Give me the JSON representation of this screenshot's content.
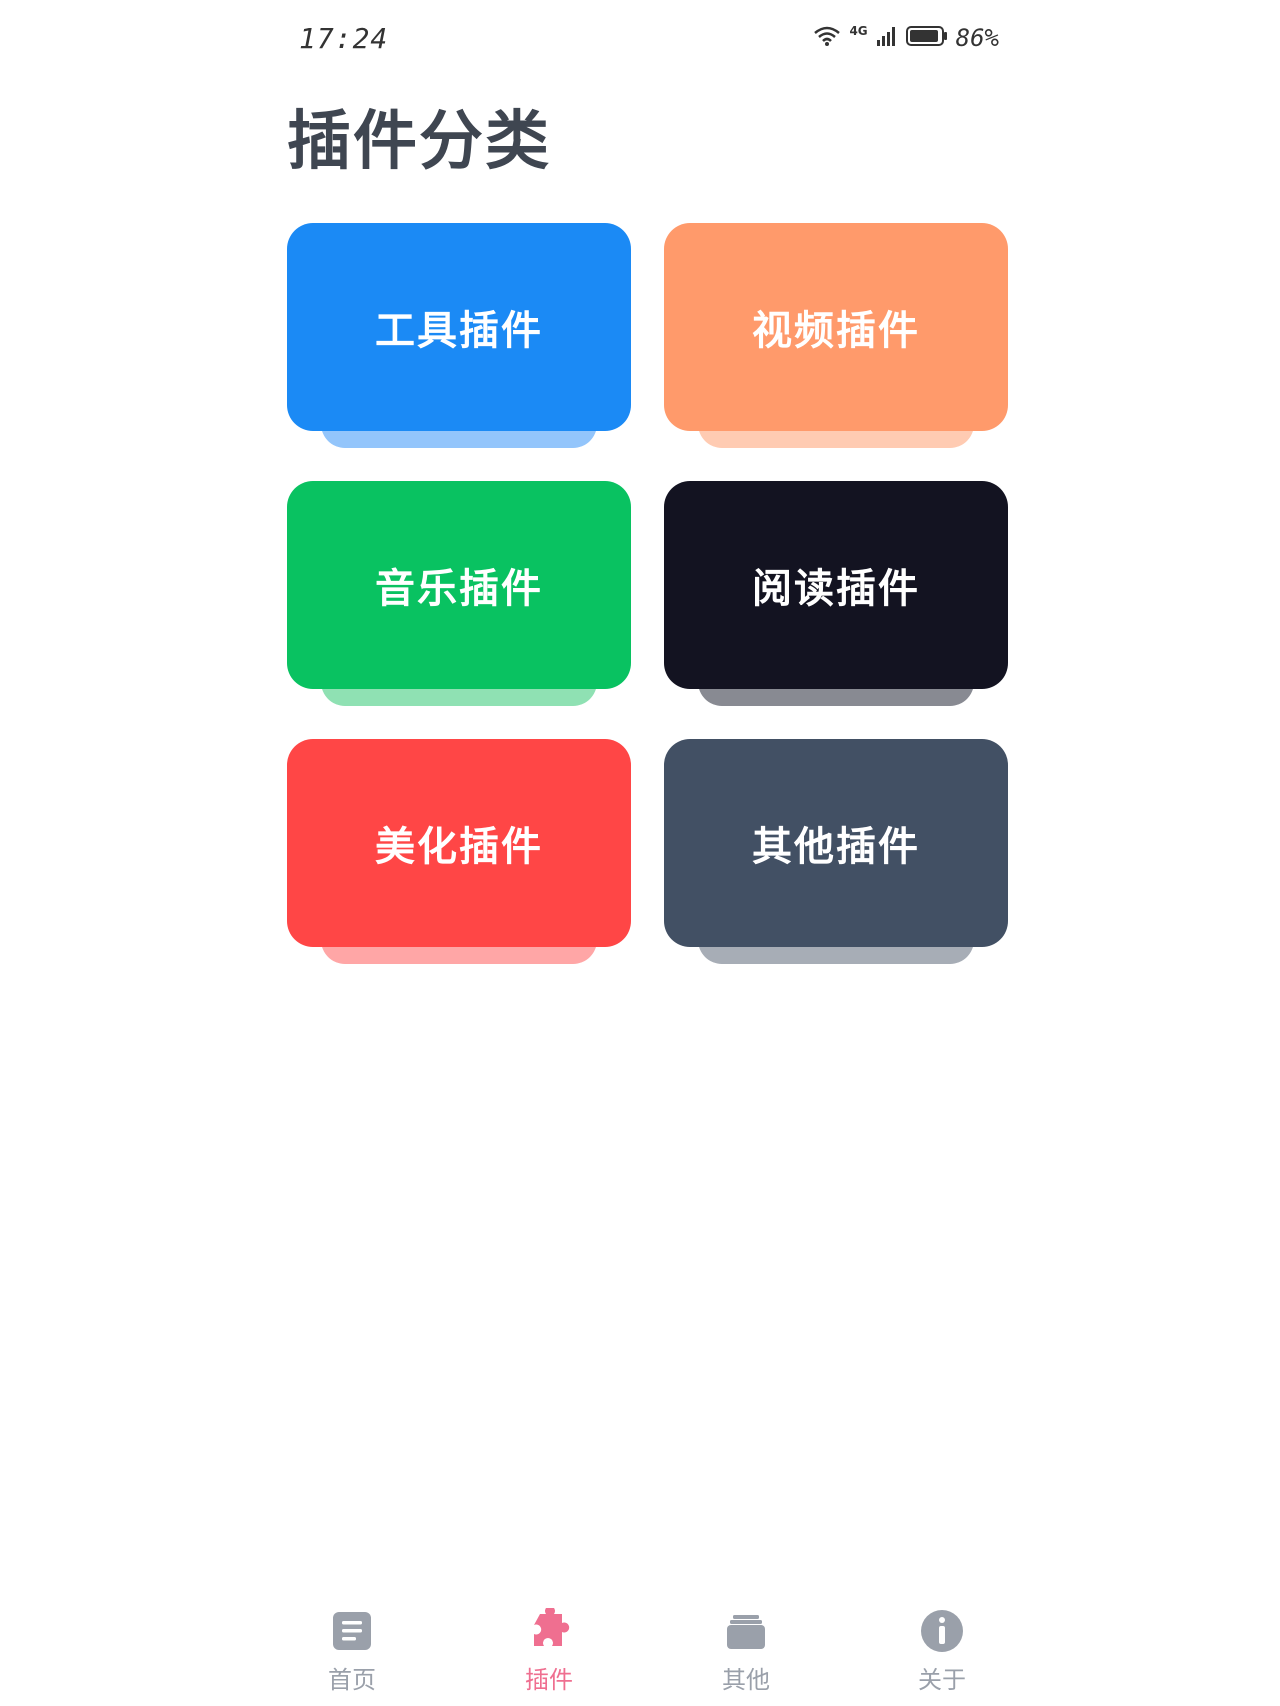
{
  "status_bar": {
    "time": "17:24",
    "network": "4G",
    "battery": "86%"
  },
  "page": {
    "title": "插件分类"
  },
  "categories": [
    {
      "label": "工具插件",
      "color": "#1b8af5",
      "shadow": "#93c5fb"
    },
    {
      "label": "视频插件",
      "color": "#ff9a6b",
      "shadow": "#ffcbb2"
    },
    {
      "label": "音乐插件",
      "color": "#09c261",
      "shadow": "#8fe1b3"
    },
    {
      "label": "阅读插件",
      "color": "#131321",
      "shadow": "#888a92"
    },
    {
      "label": "美化插件",
      "color": "#ff4646",
      "shadow": "#ffa6a6"
    },
    {
      "label": "其他插件",
      "color": "#425064",
      "shadow": "#a7adb6"
    }
  ],
  "bottom_nav": {
    "items": [
      {
        "label": "首页",
        "icon": "document-icon",
        "active": false
      },
      {
        "label": "插件",
        "icon": "puzzle-icon",
        "active": true
      },
      {
        "label": "其他",
        "icon": "folder-icon",
        "active": false
      },
      {
        "label": "关于",
        "icon": "info-icon",
        "active": false
      }
    ],
    "active_color": "#ef6f90",
    "inactive_color": "#9aa0aa"
  }
}
